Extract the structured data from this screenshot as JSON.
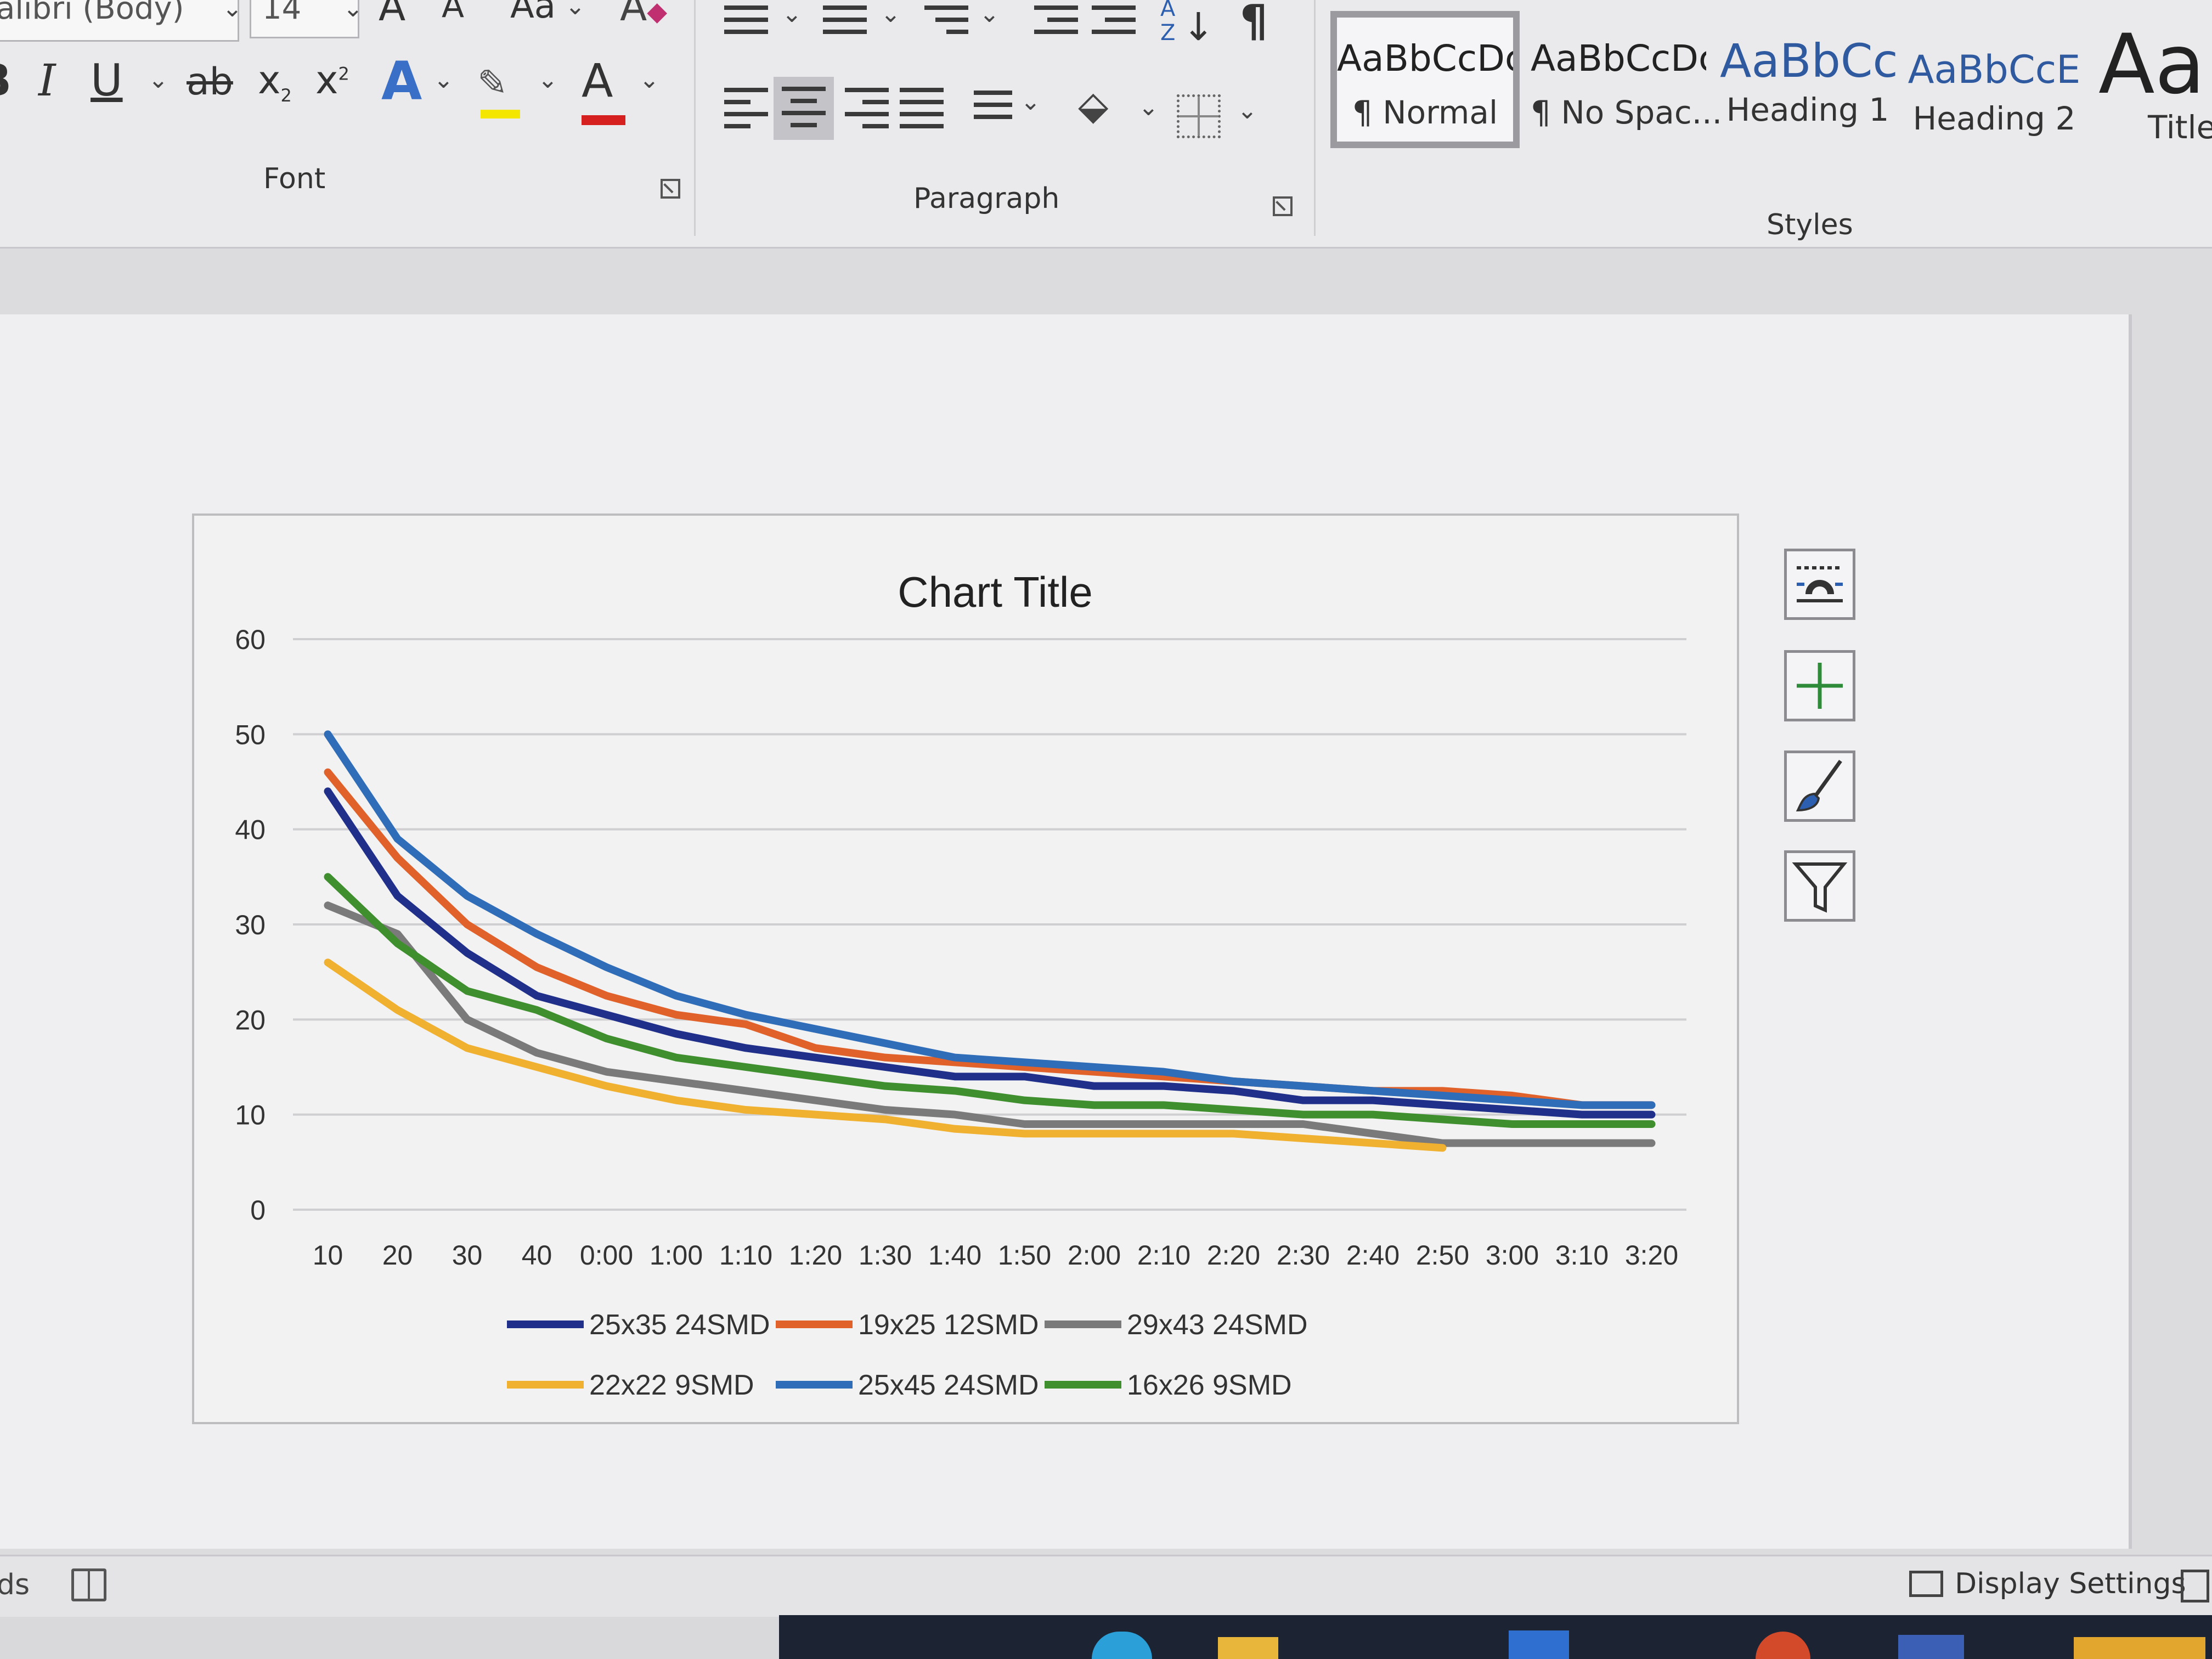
{
  "ribbon": {
    "font_group": {
      "font_name": "alibri (Body)",
      "font_size": "14",
      "grow_label": "A",
      "shrink_label": "A",
      "change_case_label": "Aa",
      "bold_label": "B",
      "italic_label": "I",
      "underline_label": "U",
      "strike_label": "ab",
      "subscript_label": "x",
      "subscript_mark": "2",
      "superscript_label": "x",
      "superscript_mark": "2",
      "text_effects_label": "A",
      "font_color_label": "A",
      "label": "Font"
    },
    "paragraph_group": {
      "sort_label": "A Z",
      "pilcrow_label": "¶",
      "label": "Paragraph"
    },
    "styles_group": {
      "label": "Styles",
      "items": [
        {
          "preview": "AaBbCcDc",
          "name": "¶ Normal"
        },
        {
          "preview": "AaBbCcDc",
          "name": "¶ No Spac..."
        },
        {
          "preview": "AaBbCc",
          "name": "Heading 1"
        },
        {
          "preview": "AaBbCcE",
          "name": "Heading 2"
        },
        {
          "preview": "Aal",
          "name": "Title"
        }
      ]
    }
  },
  "colors": {
    "highlight": "#f5e600",
    "font_color": "#d62020",
    "text_effects": "#3a6fc8"
  },
  "chart_data": {
    "type": "line",
    "title": "Chart Title",
    "categories": [
      "10",
      "20",
      "30",
      "40",
      "0:00",
      "1:00",
      "1:10",
      "1:20",
      "1:30",
      "1:40",
      "1:50",
      "2:00",
      "2:10",
      "2:20",
      "2:30",
      "2:40",
      "2:50",
      "3:00",
      "3:10",
      "3:20"
    ],
    "ylim": [
      0,
      60
    ],
    "yticks": [
      0,
      10,
      20,
      30,
      40,
      50,
      60
    ],
    "grid": true,
    "legend_position": "bottom",
    "series": [
      {
        "name": "25x35 24SMD",
        "color": "#1f2f8a",
        "values": [
          44,
          33,
          27,
          22.5,
          20.5,
          18.5,
          17,
          16,
          15,
          14,
          14,
          13,
          13,
          12.5,
          11.5,
          11.5,
          11,
          10.5,
          10,
          10
        ]
      },
      {
        "name": "19x25 12SMD",
        "color": "#e0612a",
        "values": [
          46,
          37,
          30,
          25.5,
          22.5,
          20.5,
          19.5,
          17,
          16,
          15.5,
          15,
          14.5,
          14,
          13.5,
          13,
          12.5,
          12.5,
          12,
          11,
          11
        ]
      },
      {
        "name": "29x43 24SMD",
        "color": "#7a7a7a",
        "values": [
          32,
          29,
          20,
          16.5,
          14.5,
          13.5,
          12.5,
          11.5,
          10.5,
          10,
          9,
          9,
          9,
          9,
          9,
          8,
          7,
          7,
          7,
          7
        ]
      },
      {
        "name": "22x22 9SMD",
        "color": "#f0b030",
        "values": [
          26,
          21,
          17,
          15,
          13,
          11.5,
          10.5,
          10,
          9.5,
          8.5,
          8,
          8,
          8,
          8,
          7.5,
          7,
          6.5
        ]
      },
      {
        "name": "25x45 24SMD",
        "color": "#2f6db8",
        "values": [
          50,
          39,
          33,
          29,
          25.5,
          22.5,
          20.5,
          19,
          17.5,
          16,
          15.5,
          15,
          14.5,
          13.5,
          13,
          12.5,
          12,
          11.5,
          11,
          11
        ]
      },
      {
        "name": "16x26 9SMD",
        "color": "#3f8f2f",
        "values": [
          35,
          28,
          23,
          21,
          18,
          16,
          15,
          14,
          13,
          12.5,
          11.5,
          11,
          11,
          10.5,
          10,
          10,
          9.5,
          9,
          9,
          9
        ]
      }
    ]
  },
  "status_bar": {
    "left_text": "ds",
    "display_settings_label": "Display Settings"
  }
}
